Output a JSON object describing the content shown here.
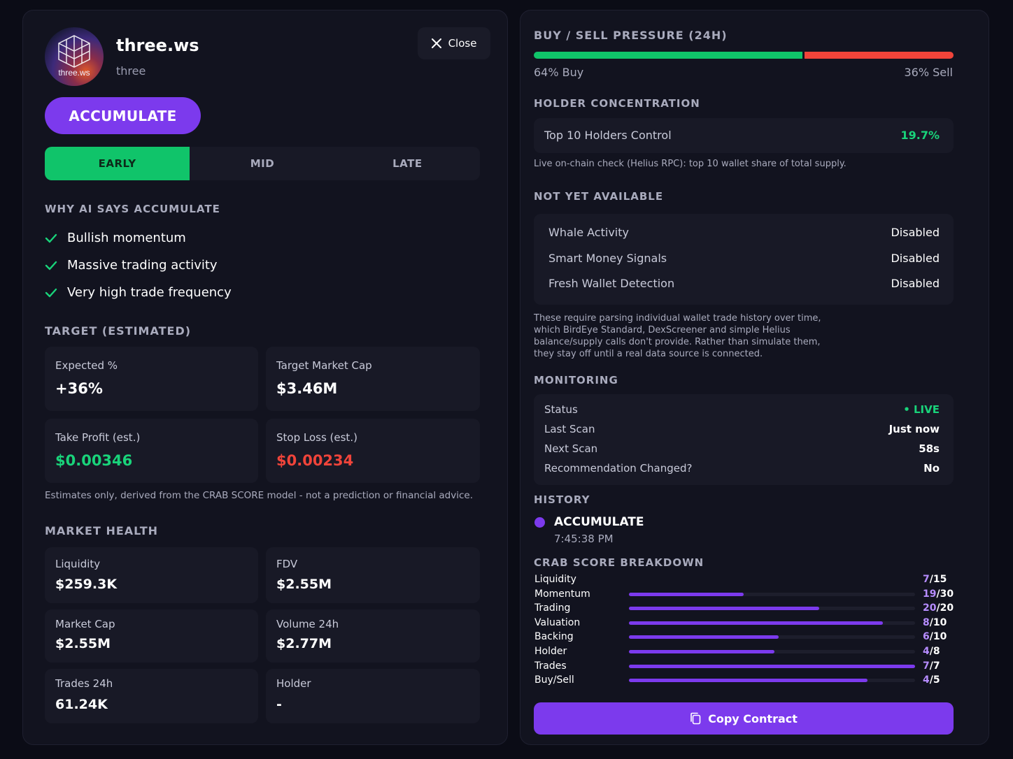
{
  "token": {
    "name": "three.ws",
    "symbol": "three",
    "avatar_text": "three.ws"
  },
  "header": {
    "close_label": "Close"
  },
  "recommendation": {
    "label": "ACCUMULATE"
  },
  "stages": [
    {
      "label": "EARLY",
      "active": true
    },
    {
      "label": "MID",
      "active": false
    },
    {
      "label": "LATE",
      "active": false
    }
  ],
  "why": {
    "title": "WHY AI SAYS ACCUMULATE",
    "reasons": [
      "Bullish momentum",
      "Massive trading activity",
      "Very high trade frequency"
    ]
  },
  "target": {
    "title": "TARGET (ESTIMATED)",
    "expected_label": "Expected %",
    "expected_value": "+36%",
    "mcap_label": "Target Market Cap",
    "mcap_value": "$3.46M",
    "tp_label": "Take Profit (est.)",
    "tp_value": "$0.00346",
    "sl_label": "Stop Loss (est.)",
    "sl_value": "$0.00234",
    "note": "Estimates only, derived from the CRAB SCORE model - not a prediction or financial advice."
  },
  "market_health": {
    "title": "MARKET HEALTH",
    "liquidity_label": "Liquidity",
    "liquidity_value": "$259.3K",
    "fdv_label": "FDV",
    "fdv_value": "$2.55M",
    "mcap_label": "Market Cap",
    "mcap_value": "$2.55M",
    "volume_label": "Volume 24h",
    "volume_value": "$2.77M",
    "trades_label": "Trades 24h",
    "trades_value": "61.24K",
    "holder_label": "Holder",
    "holder_value": "-"
  },
  "pressure": {
    "title": "BUY / SELL PRESSURE (24H)",
    "buy_pct": 64,
    "buy_label": "64% Buy",
    "sell_label": "36% Sell",
    "buy_color": "#10c46a",
    "sell_color": "#f0443a"
  },
  "holders": {
    "title": "HOLDER CONCENTRATION",
    "label": "Top 10 Holders Control",
    "value": "19.7%",
    "note": "Live on-chain check (Helius RPC): top 10 wallet share of total supply."
  },
  "not_available": {
    "title": "NOT YET AVAILABLE",
    "rows": [
      {
        "label": "Whale Activity",
        "value": "Disabled"
      },
      {
        "label": "Smart Money Signals",
        "value": "Disabled"
      },
      {
        "label": "Fresh Wallet Detection",
        "value": "Disabled"
      }
    ],
    "note_lines": [
      "These require parsing individual wallet trade history over time,",
      "which BirdEye Standard, DexScreener and simple Helius",
      "balance/supply calls don't provide. Rather than simulate them,",
      "they stay off until a real data source is connected."
    ]
  },
  "monitoring": {
    "title": "MONITORING",
    "status_label": "Status",
    "status_value": "• LIVE",
    "last_label": "Last Scan",
    "last_value": "Just now",
    "next_label": "Next Scan",
    "next_value": "58s",
    "changed_label": "Recommendation Changed?",
    "changed_value": "No"
  },
  "history": {
    "title": "HISTORY",
    "entry_label": "ACCUMULATE",
    "entry_time": "7:45:38 PM"
  },
  "crab": {
    "title": "CRAB SCORE BREAKDOWN",
    "rows": [
      {
        "label": "Liquidity",
        "score": "7",
        "max": "/15",
        "fraction": 0.4667,
        "show_bar": false
      },
      {
        "label": "Momentum",
        "score": "19",
        "max": "/30",
        "fraction": 0.4,
        "show_bar": true
      },
      {
        "label": "Trading",
        "score": "20",
        "max": "/20",
        "fraction": 0.665,
        "show_bar": true
      },
      {
        "label": "Valuation",
        "score": "8",
        "max": "/10",
        "fraction": 0.887,
        "show_bar": true
      },
      {
        "label": "Backing",
        "score": "6",
        "max": "/10",
        "fraction": 0.523,
        "show_bar": true
      },
      {
        "label": "Holder",
        "score": "4",
        "max": "/8",
        "fraction": 0.509,
        "show_bar": true
      },
      {
        "label": "Trades",
        "score": "7",
        "max": "/7",
        "fraction": 1.0,
        "show_bar": true
      },
      {
        "label": "Buy/Sell",
        "score": "4",
        "max": "/5",
        "fraction": 0.833,
        "show_bar": true
      }
    ]
  },
  "copy": {
    "label": "Copy Contract"
  }
}
